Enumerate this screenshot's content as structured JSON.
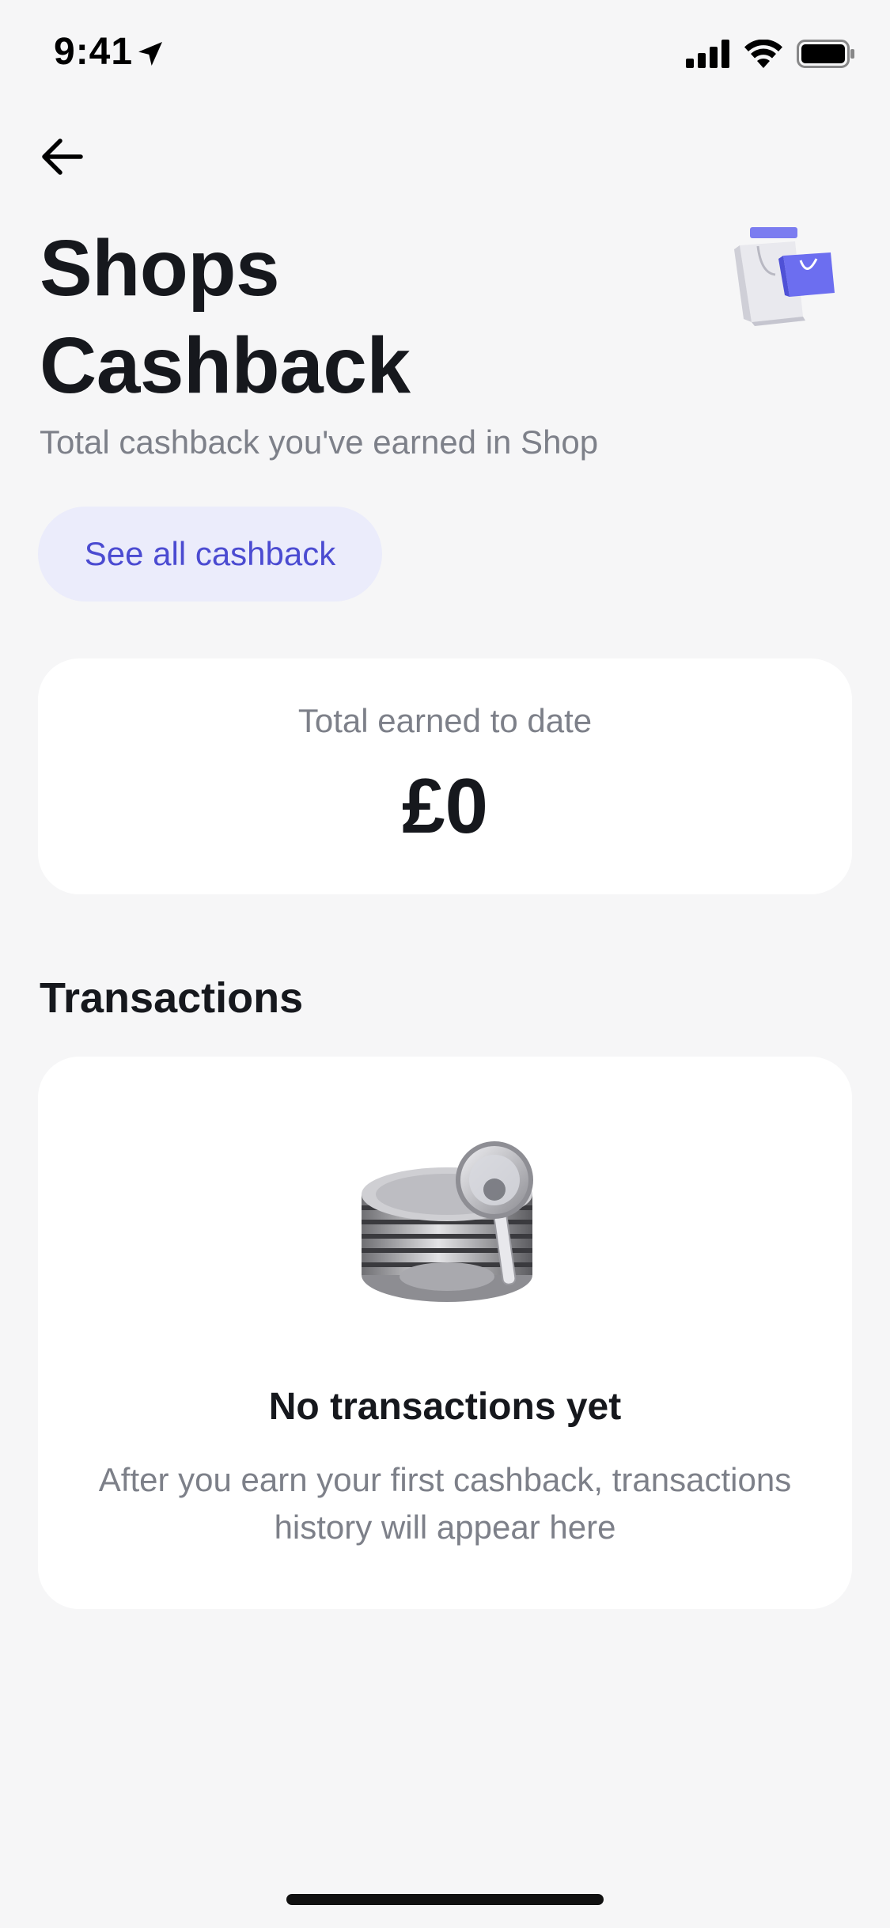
{
  "status_bar": {
    "time": "9:41"
  },
  "header": {
    "title": "Shops Cashback",
    "subtitle": "Total cashback you've earned in Shop"
  },
  "actions": {
    "see_all_label": "See all cashback"
  },
  "total_card": {
    "label": "Total earned to date",
    "amount": "£0"
  },
  "transactions": {
    "section_title": "Transactions",
    "empty_title": "No transactions yet",
    "empty_text": "After you earn your first cashback, transactions history will appear here"
  },
  "colors": {
    "background": "#f6f6f7",
    "card": "#ffffff",
    "accent": "#4b4bd1",
    "accent_bg": "#ebecfb",
    "muted_text": "#7d8089",
    "primary_text": "#16181d"
  },
  "icons": {
    "back": "arrow-left-icon",
    "location": "location-arrow-icon",
    "signal": "cellular-signal-icon",
    "wifi": "wifi-icon",
    "battery": "battery-icon",
    "hero": "shopping-bags-icon",
    "empty": "coins-magnifier-icon"
  }
}
